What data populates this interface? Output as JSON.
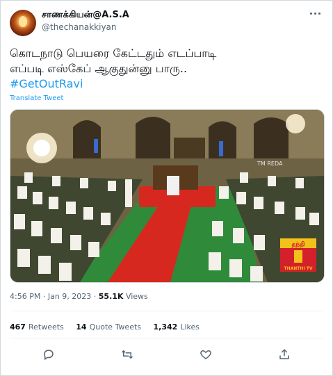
{
  "author": {
    "display_name": "சாணக்கியன்@A.S.A",
    "handle": "@thechanakkiyan",
    "avatar_icon": "avatar-image"
  },
  "tweet": {
    "line1": "கொடநாடு பெயரை கேட்டதும் எடப்பாடி",
    "line2": "எப்படி எஸ்கேப் ஆகுதுன்னு பாரு..",
    "hashtag": "#GetOutRavi",
    "translate_label": "Translate Tweet"
  },
  "media": {
    "type": "video-thumbnail",
    "watermark_logo": "தந்தி",
    "watermark_text": "THANTHI TV",
    "corner_text": "TM REDA"
  },
  "meta": {
    "time": "4:56 PM",
    "separator": "·",
    "date": "Jan 9, 2023",
    "views_count": "55.1K",
    "views_label": "Views"
  },
  "stats": {
    "retweets_count": "467",
    "retweets_label": "Retweets",
    "quotes_count": "14",
    "quotes_label": "Quote Tweets",
    "likes_count": "1,342",
    "likes_label": "Likes"
  },
  "actions": [
    "reply-icon",
    "retweet-icon",
    "like-icon",
    "share-icon"
  ],
  "colors": {
    "accent": "#1d9bf0",
    "muted": "#536471",
    "text": "#0f1419",
    "divider": "#eff3f4"
  }
}
